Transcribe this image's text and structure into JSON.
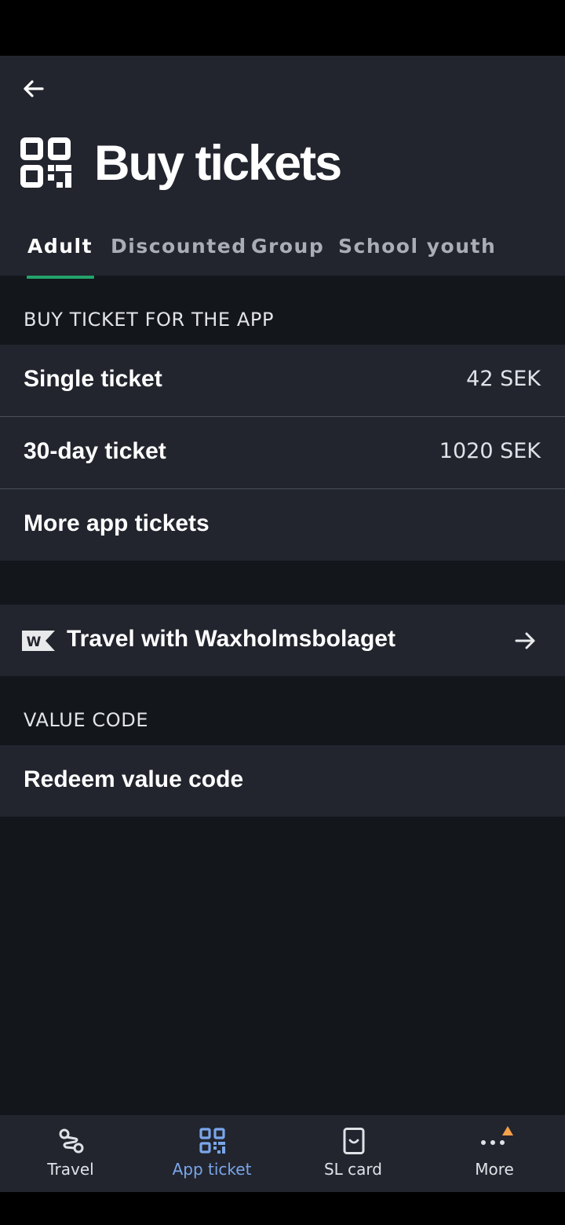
{
  "header": {
    "title": "Buy tickets",
    "tabs": [
      {
        "label": "Adult",
        "active": true
      },
      {
        "label": "Discounted",
        "active": false
      },
      {
        "label": "Group",
        "active": false
      },
      {
        "label": "School youth",
        "active": false
      }
    ]
  },
  "sections": {
    "app_ticket_label": "BUY TICKET FOR THE APP",
    "value_code_label": "VALUE CODE"
  },
  "tickets": [
    {
      "title": "Single ticket",
      "price": "42 SEK"
    },
    {
      "title": "30-day ticket",
      "price": "1020 SEK"
    },
    {
      "title": "More app tickets",
      "price": ""
    }
  ],
  "waxholm": {
    "label": "Travel with Waxholmsbolaget",
    "logo_letter": "W"
  },
  "value_code": {
    "label": "Redeem value code"
  },
  "bottom_nav": [
    {
      "label": "Travel",
      "icon": "route-icon",
      "active": false
    },
    {
      "label": "App ticket",
      "icon": "qr-code-icon",
      "active": true
    },
    {
      "label": "SL card",
      "icon": "card-icon",
      "active": false
    },
    {
      "label": "More",
      "icon": "more-dots-icon",
      "active": false
    }
  ],
  "colors": {
    "accent_tab": "#24a36b",
    "active_nav": "#7aa6ea",
    "notification": "#f4a14b",
    "surface": "#22252e",
    "background": "#13161a"
  }
}
